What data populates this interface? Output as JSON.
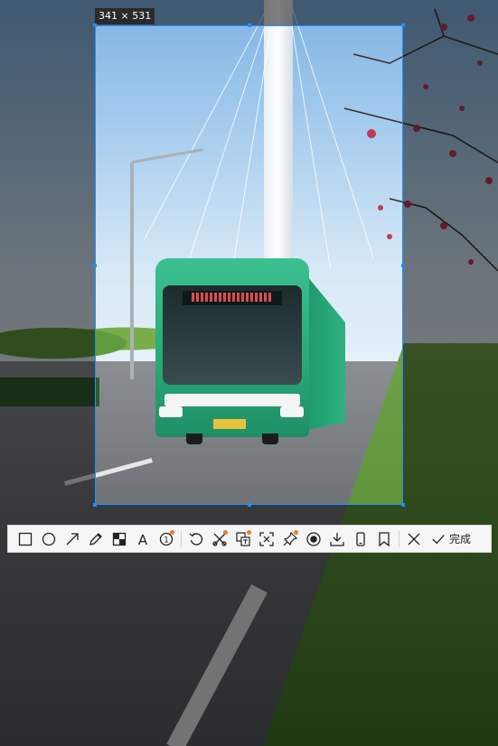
{
  "selection": {
    "size_label": "341 × 531"
  },
  "toolbar": {
    "tools": [
      {
        "icon": "rectangle-icon",
        "badge": false
      },
      {
        "icon": "ellipse-icon",
        "badge": false
      },
      {
        "icon": "arrow-icon",
        "badge": false
      },
      {
        "icon": "pencil-icon",
        "badge": false
      },
      {
        "icon": "mosaic-icon",
        "badge": false
      },
      {
        "icon": "text-icon",
        "badge": false
      },
      {
        "icon": "number-marker-icon",
        "badge": false
      },
      {
        "icon": "undo-icon",
        "badge": false
      },
      {
        "icon": "cut-ocr-icon",
        "badge": true
      },
      {
        "icon": "translate-icon",
        "badge": true
      },
      {
        "icon": "scan-icon",
        "badge": false
      },
      {
        "icon": "pin-icon",
        "badge": true
      },
      {
        "icon": "record-icon",
        "badge": false
      },
      {
        "icon": "download-icon",
        "badge": false
      },
      {
        "icon": "phone-icon",
        "badge": false
      },
      {
        "icon": "bookmark-icon",
        "badge": false
      },
      {
        "icon": "close-icon",
        "badge": false
      }
    ],
    "text_tool_glyph": "A",
    "number_tool_glyph": "1",
    "done_label": "完成",
    "badge_color": "#f07a20",
    "selection_color": "#1e90ff"
  }
}
